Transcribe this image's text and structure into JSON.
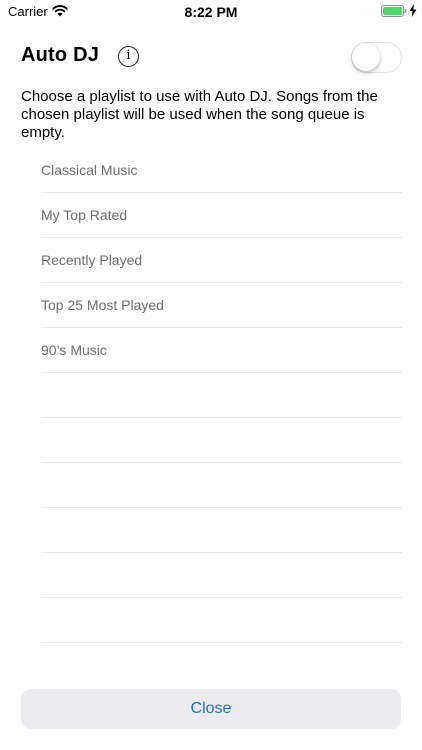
{
  "status_bar": {
    "carrier": "Carrier",
    "time": "8:22 PM",
    "wifi_icon": "wifi-icon",
    "battery_icon": "battery-charging-icon",
    "battery_color": "#4cd964"
  },
  "header": {
    "title": "Auto DJ",
    "info_icon": "info-icon",
    "info_glyph": "i",
    "toggle_on": false
  },
  "description": "Choose a playlist to use with Auto DJ. Songs from the chosen playlist will be used when the song queue is empty.",
  "playlists": [
    "Classical Music",
    "My Top Rated",
    "Recently Played",
    "Top 25 Most Played",
    "90’s Music",
    "",
    "",
    "",
    "",
    "",
    "",
    ""
  ],
  "footer": {
    "close_label": "Close",
    "accent_color": "#1f6fd6"
  }
}
